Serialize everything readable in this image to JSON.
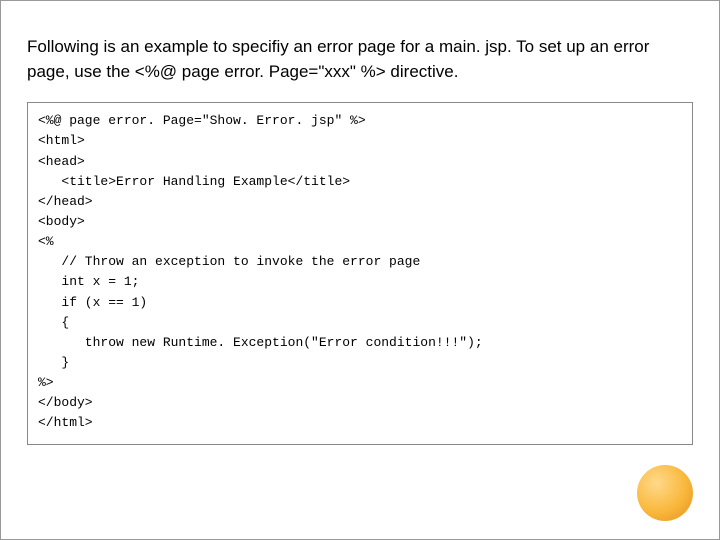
{
  "heading": {
    "part1": "Following is an example to specifiy an error page for a main. jsp. To set up an error page, use the ",
    "directive": "<%@ page error. Page=\"xxx\" %>",
    "part2": " directive."
  },
  "code_lines": [
    "<%@ page error. Page=\"Show. Error. jsp\" %>",
    "<html>",
    "<head>",
    "   <title>Error Handling Example</title>",
    "</head>",
    "<body>",
    "<%",
    "   // Throw an exception to invoke the error page",
    "   int x = 1;",
    "   if (x == 1)",
    "   {",
    "      throw new Runtime. Exception(\"Error condition!!!\");",
    "   }",
    "%>",
    "</body>",
    "</html>"
  ],
  "decor": {
    "circle": "orange-circle"
  }
}
